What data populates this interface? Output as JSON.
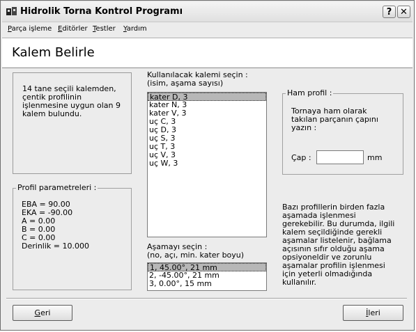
{
  "window": {
    "title": "Hidrolik Torna Kontrol Programı",
    "help_glyph": "?",
    "close_glyph": "✕"
  },
  "menu": [
    {
      "u": "P",
      "rest": "arça işleme"
    },
    {
      "u": "E",
      "rest": "ditörler"
    },
    {
      "u": "T",
      "rest": "estler"
    },
    {
      "u": "Y",
      "rest": "ardım"
    }
  ],
  "header": {
    "title": "Kalem Belirle"
  },
  "info": {
    "lines": [
      "14 tane seçili kalemden,",
      "çentik profilinin",
      "işlenmesine uygun olan 9",
      "kalem bulundu."
    ]
  },
  "profile_params": {
    "legend": "Profil parametreleri :",
    "lines": [
      "EBA = 90.00",
      "EKA = -90.00",
      "A = 0.00",
      "B = 0.00",
      "C = 0.00",
      "Derinlik = 10.000"
    ]
  },
  "tool_select": {
    "label_lines": [
      "Kullanılacak kalemi seçin :",
      "(isim, aşama sayısı)"
    ],
    "items": [
      "kater D, 3",
      "kater N, 3",
      "kater V, 3",
      "uç C, 3",
      "uç D, 3",
      "uç S, 3",
      "uç T, 3",
      "uç V, 3",
      "uç W, 3"
    ],
    "selected_index": 0
  },
  "stage_select": {
    "label_lines": [
      "Aşamayı seçin :",
      "(no, açı, min. kater boyu)"
    ],
    "items": [
      "1, 45.00°, 21 mm",
      "2, -45.00°, 21 mm",
      "3, 0.00°, 15 mm"
    ],
    "selected_index": 0
  },
  "raw_profile": {
    "legend": "Ham profil :",
    "lines": [
      "Tornaya ham olarak",
      "takılan parçanın çapını",
      "yazın :"
    ],
    "diameter_label": "Çap :",
    "diameter_value": "",
    "unit": "mm"
  },
  "note": {
    "lines": [
      "Bazı profillerin birden fazla",
      "aşamada işlenmesi",
      "gerekebilir. Bu durumda, ilgili",
      "kalem seçildiğinde gerekli",
      "aşamalar listelenir, bağlama",
      "açısının sıfır olduğu aşama",
      "opsiyoneldir ve zorunlu",
      "aşamalar profilin işlenmesi",
      "için yeterli olmadığında",
      "kullanılır."
    ]
  },
  "buttons": {
    "back": {
      "u": "G",
      "rest": "eri"
    },
    "next": {
      "u": "İ",
      "rest": "leri"
    }
  }
}
